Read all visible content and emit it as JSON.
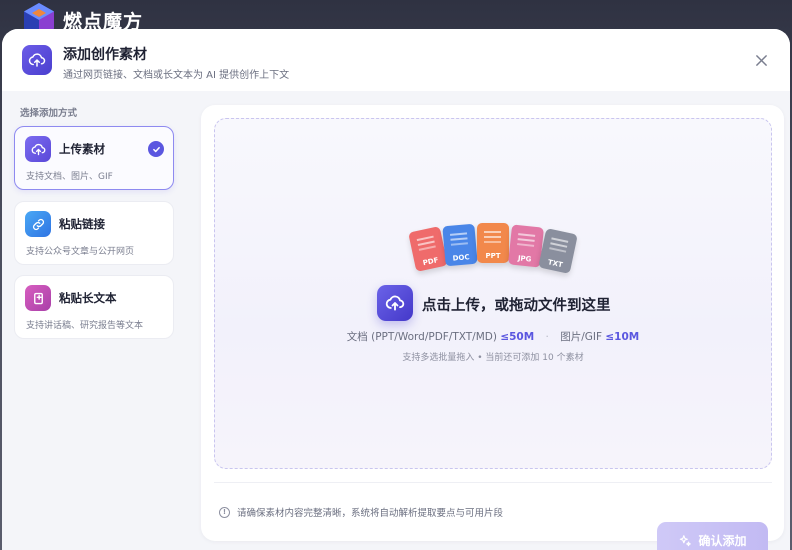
{
  "app": {
    "name": "燃点魔方"
  },
  "modal": {
    "title": "添加创作素材",
    "subtitle": "通过网页链接、文档或长文本为 AI 提供创作上下文",
    "close_icon": "close-icon"
  },
  "sidebar": {
    "heading": "选择添加方式",
    "options": [
      {
        "title": "上传素材",
        "desc": "支持文档、图片、GIF",
        "icon": "upload-cloud-icon",
        "selected": true,
        "color": "#6c5ce7"
      },
      {
        "title": "粘贴链接",
        "desc": "支持公众号文章与公开网页",
        "icon": "link-icon",
        "selected": false,
        "color": "#3b8cf0"
      },
      {
        "title": "粘贴长文本",
        "desc": "支持讲话稿、研究报告等文本",
        "icon": "paste-text-icon",
        "selected": false,
        "color": "#c44fb5"
      }
    ]
  },
  "upload": {
    "file_types": [
      {
        "label": "PDF",
        "color": "#ef6b6b"
      },
      {
        "label": "DOC",
        "color": "#4a86e8"
      },
      {
        "label": "PPT",
        "color": "#f2884b"
      },
      {
        "label": "JPG",
        "color": "#e278a6"
      },
      {
        "label": "TXT",
        "color": "#8a8f9e"
      }
    ],
    "title": "点击上传，或拖动文件到这里",
    "doc_formats": "文档 (PPT/Word/PDF/TXT/MD)",
    "doc_limit": "≤50M",
    "separator": "·",
    "img_formats": "图片/GIF",
    "img_limit": "≤10M",
    "hint": "支持多选批量拖入 • 当前还可添加 10 个素材"
  },
  "footer": {
    "note": "请确保素材内容完整清晰，系统将自动解析提取要点与可用片段",
    "confirm_label": "确认添加"
  },
  "colors": {
    "accent": "#5b57e0",
    "confirm_disabled": "#c8c1f5"
  }
}
